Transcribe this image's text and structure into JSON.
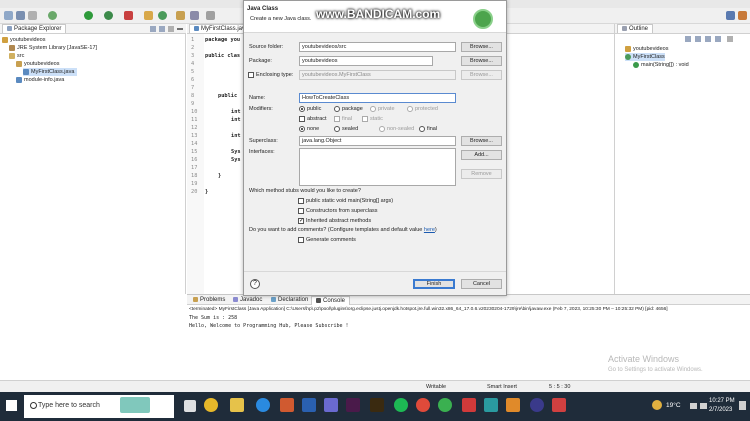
{
  "watermark": "www.BANDICAM.com",
  "package_explorer": {
    "tab": "Package Explorer",
    "items": [
      {
        "label": "youtubevideos",
        "indent": 0
      },
      {
        "label": "JRE System Library [JavaSE-17]",
        "indent": 1
      },
      {
        "label": "src",
        "indent": 1
      },
      {
        "label": "youtubevideos",
        "indent": 2
      },
      {
        "label": "MyFirstClass.java",
        "indent": 3
      },
      {
        "label": "module-info.java",
        "indent": 2
      }
    ]
  },
  "editor": {
    "tab": "MyFirstClass.java",
    "line_numbers": [
      "1",
      "2",
      "3",
      "4",
      "5",
      "6",
      "7",
      "8",
      "9",
      "10",
      "11",
      "12",
      "13",
      "14",
      "15",
      "16",
      "17",
      "18",
      "19",
      "20"
    ],
    "lines": [
      "package you",
      "",
      "public clas",
      "",
      "",
      "",
      "",
      "public",
      "",
      "int",
      "int",
      "",
      "int",
      "",
      "Sys",
      "Sys",
      "",
      "}",
      "",
      "}"
    ]
  },
  "outline": {
    "tab": "Outline",
    "items": [
      "youtubevideos",
      "MyFirstClass",
      "main(String[]) : void"
    ]
  },
  "dialog": {
    "title": "Java Class",
    "subtitle": "Create a new Java class.",
    "source_folder_label": "Source folder:",
    "source_folder_value": "youtubevideos/src",
    "package_label": "Package:",
    "package_value": "youtubevideos",
    "enclosing_label": "Enclosing type:",
    "enclosing_value": "youtubevideos.MyFirstClass",
    "browse": "Browse...",
    "name_label": "Name:",
    "name_value": "HowToCreateClass",
    "modifiers_label": "Modifiers:",
    "mod_public": "public",
    "mod_package": "package",
    "mod_private": "private",
    "mod_protected": "protected",
    "mod_abstract": "abstract",
    "mod_final": "final",
    "mod_static": "static",
    "mod_none": "none",
    "mod_sealed": "sealed",
    "mod_nonsealed": "non-sealed",
    "mod_final2": "final",
    "superclass_label": "Superclass:",
    "superclass_value": "java.lang.Object",
    "interfaces_label": "Interfaces:",
    "add": "Add...",
    "remove": "Remove",
    "stubs_question": "Which method stubs would you like to create?",
    "stub_main": "public static void main(String[] args)",
    "stub_ctors": "Constructors from superclass",
    "stub_inherited": "Inherited abstract methods",
    "comments_question": "Do you want to add comments? (Configure templates and default value",
    "comments_link": "here",
    "comments_close": ")",
    "gen_comments": "Generate comments",
    "help": "?",
    "finish": "Finish",
    "cancel": "Cancel"
  },
  "console": {
    "tabs": [
      "Problems",
      "Javadoc",
      "Declaration",
      "Console"
    ],
    "terminated": "<terminated> MyFirstClass [Java Application] C:\\Users\\hp\\.p2\\pool\\plugins\\org.eclipse.justj.openjdk.hotspot.jre.full.win32.x86_64_17.0.6.v20230204-1729\\jre\\bin\\javaw.exe  (Feb 7, 2023, 10:25:30 PM – 10:25:32 PM) [pid: 4656]",
    "out1": "The Sum is : 258",
    "out2": "Hello, Welcome to Programming Hub, Please Subscribe !"
  },
  "status_bar": {
    "writable": "Writable",
    "insert": "Smart Insert",
    "position": "5 : 5 : 30"
  },
  "activate": {
    "title": "Activate Windows",
    "sub": "Go to Settings to activate Windows."
  },
  "taskbar": {
    "search_placeholder": "Type here to search",
    "temp": "19°C",
    "time": "10:27 PM",
    "date": "2/7/2023"
  }
}
